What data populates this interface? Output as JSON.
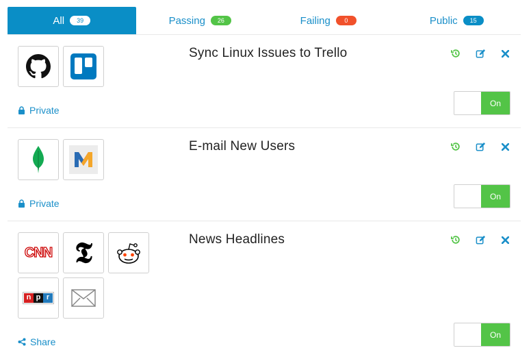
{
  "tabs": [
    {
      "label": "All",
      "count": "39",
      "active": true,
      "badge_color": "#ffffff"
    },
    {
      "label": "Passing",
      "count": "26",
      "badge_color": "#53c447"
    },
    {
      "label": "Failing",
      "count": "0",
      "badge_color": "#f1512b"
    },
    {
      "label": "Public",
      "count": "15",
      "badge_color": "#0a8ec6"
    }
  ],
  "colors": {
    "accent": "#0a8ec6",
    "link": "#1a8fc9",
    "on_green": "#53c447",
    "history_green": "#53c447",
    "edit_blue": "#1a8fc9"
  },
  "recipes": [
    {
      "title": "Sync Linux Issues to Trello",
      "services": [
        "github-icon",
        "trello-icon"
      ],
      "privacy_label": "Private",
      "privacy_icon": "lock-icon",
      "toggle_label": "On"
    },
    {
      "title": "E-mail New Users",
      "services": [
        "mongodb-icon",
        "mailchimp-m-icon"
      ],
      "privacy_label": "Private",
      "privacy_icon": "lock-icon",
      "toggle_label": "On"
    },
    {
      "title": "News Headlines",
      "services": [
        "cnn-icon",
        "nyt-icon",
        "reddit-icon",
        "npr-icon",
        "email-envelope-icon"
      ],
      "privacy_label": "Share",
      "privacy_icon": "share-icon",
      "toggle_label": "On"
    }
  ],
  "logo_text": {
    "cnn": "CNN",
    "npr": [
      "n",
      "p",
      "r"
    ]
  }
}
